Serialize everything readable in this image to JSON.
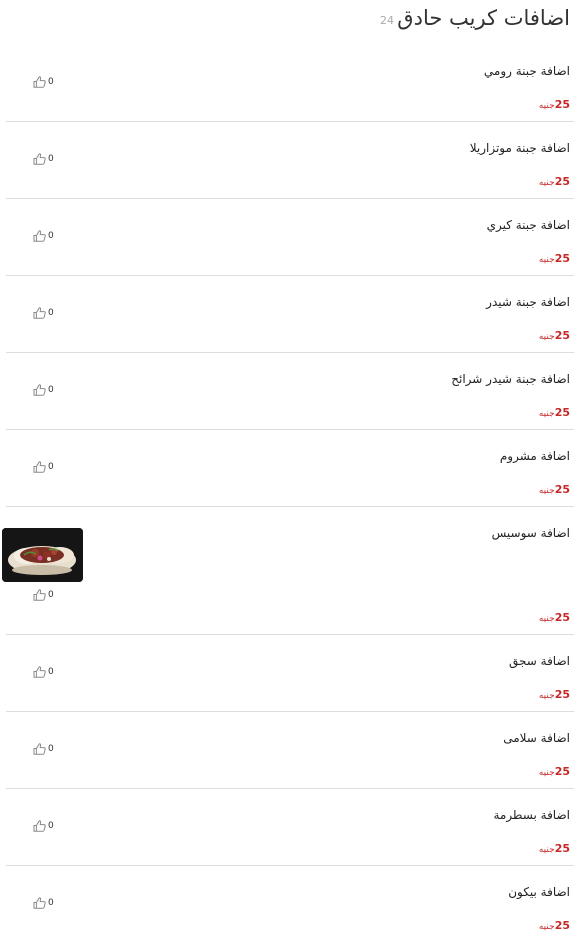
{
  "header": {
    "title": "اضافات كريب حادق",
    "count": "24"
  },
  "currency": "جنيه",
  "items": [
    {
      "name": "اضافة جبنة رومي",
      "price": "25",
      "likes": "0"
    },
    {
      "name": "اضافة جبنة موتزاريلا",
      "price": "25",
      "likes": "0"
    },
    {
      "name": "اضافة جبنة كيري",
      "price": "25",
      "likes": "0"
    },
    {
      "name": "اضافة جبنة شيدر",
      "price": "25",
      "likes": "0"
    },
    {
      "name": "اضافة جبنة شيدر شرائح",
      "price": "25",
      "likes": "0"
    },
    {
      "name": "اضافة مشروم",
      "price": "25",
      "likes": "0"
    },
    {
      "name": "اضافة سوسيس",
      "price": "25",
      "likes": "0",
      "has_image": true
    },
    {
      "name": "اضافة سجق",
      "price": "25",
      "likes": "0"
    },
    {
      "name": "اضافة سلامى",
      "price": "25",
      "likes": "0"
    },
    {
      "name": "اضافة بسطرمة",
      "price": "25",
      "likes": "0"
    },
    {
      "name": "اضافة بيكون",
      "price": "25",
      "likes": "0"
    }
  ],
  "icons": {
    "like": "thumbs-up-icon"
  },
  "colors": {
    "price": "#c62828",
    "divider": "#dedede"
  }
}
